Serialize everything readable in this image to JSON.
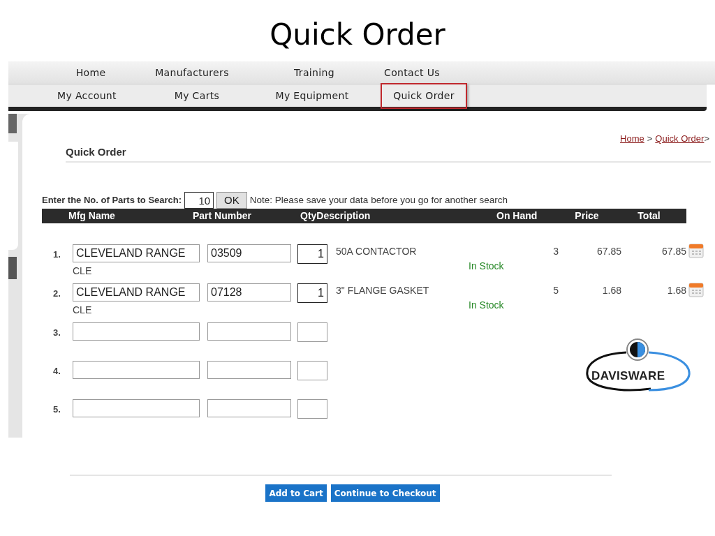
{
  "slide_title": "Quick Order",
  "nav_top": [
    {
      "label": "Home",
      "selected": false
    },
    {
      "label": "Manufacturers",
      "selected": false
    },
    {
      "label": "Training",
      "selected": false
    },
    {
      "label": "Contact Us",
      "selected": false
    }
  ],
  "nav_bottom": [
    {
      "label": "My Account",
      "selected": false
    },
    {
      "label": "My Carts",
      "selected": false
    },
    {
      "label": "My Equipment",
      "selected": false
    },
    {
      "label": "Quick Order",
      "selected": true
    }
  ],
  "breadcrumb": {
    "home": "Home",
    "separator": ">",
    "current": "Quick Order",
    "trail": ">"
  },
  "heading": "Quick Order",
  "search": {
    "label": "Enter the No. of Parts to Search:",
    "value": "10",
    "button": "OK",
    "note": "Note: Please save your data before you go for another search"
  },
  "table": {
    "columns": [
      "Mfg Name",
      "Part Number",
      "Qty",
      "Description",
      "On Hand",
      "Price",
      "Total"
    ],
    "rows": [
      {
        "number": "1.",
        "mfg": "CLEVELAND RANGE",
        "mfg_code": "CLE",
        "part": "03509",
        "qty": "1",
        "description": "50A CONTACTOR",
        "stock": "In Stock",
        "on_hand": "3",
        "price": "67.85",
        "total": "67.85"
      },
      {
        "number": "2.",
        "mfg": "CLEVELAND RANGE",
        "mfg_code": "CLE",
        "part": "07128",
        "qty": "1",
        "description": "3\" FLANGE GASKET",
        "stock": "In Stock",
        "on_hand": "5",
        "price": "1.68",
        "total": "1.68"
      },
      {
        "number": "3."
      },
      {
        "number": "4."
      },
      {
        "number": "5."
      }
    ]
  },
  "logo": "DAVISWARE",
  "buttons": [
    "Add to Cart",
    "Continue to Checkout"
  ]
}
